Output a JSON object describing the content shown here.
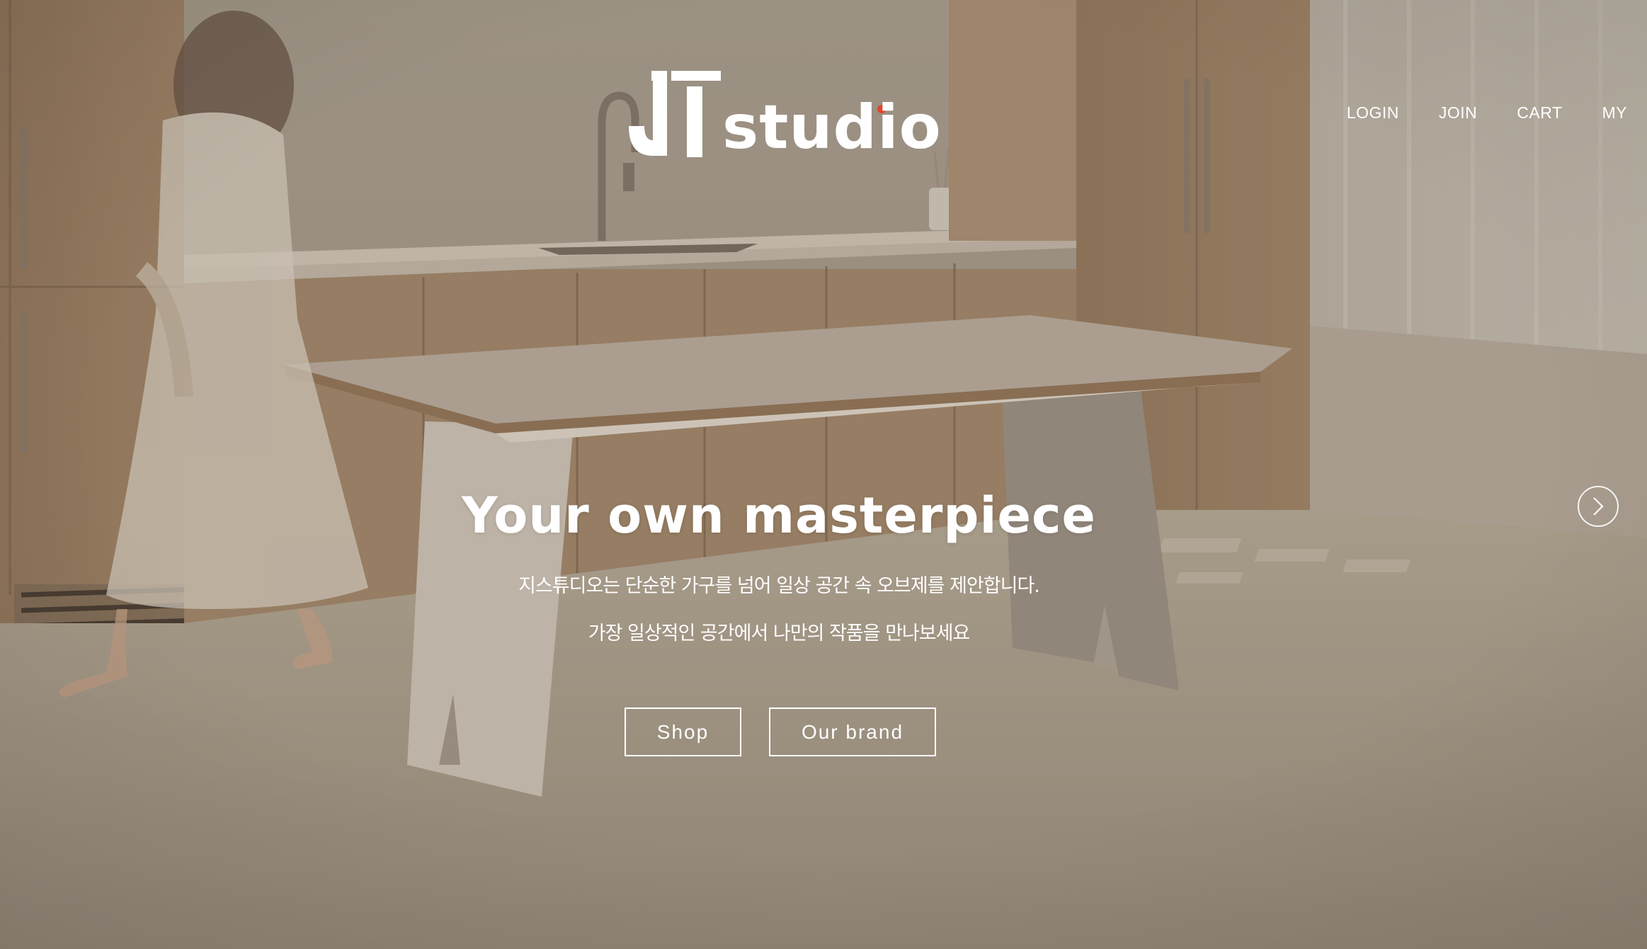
{
  "brand": {
    "name": "JT studio",
    "logo_text": "studio",
    "logo_accent_color": "#e0452a"
  },
  "nav": {
    "items": [
      {
        "label": "LOGIN"
      },
      {
        "label": "JOIN"
      },
      {
        "label": "CART"
      },
      {
        "label": "MY"
      }
    ]
  },
  "hero": {
    "headline": "Your own masterpiece",
    "subline_1": "지스튜디오는 단순한 가구를 넘어 일상 공간 속 오브제를 제안합니다.",
    "subline_2": "가장 일상적인 공간에서 나만의 작품을 만나보세요",
    "buttons": {
      "shop": "Shop",
      "brand": "Our brand"
    },
    "next_icon": "chevron-right-icon"
  },
  "colors": {
    "overlay": "#8d8376",
    "text": "#ffffff"
  }
}
